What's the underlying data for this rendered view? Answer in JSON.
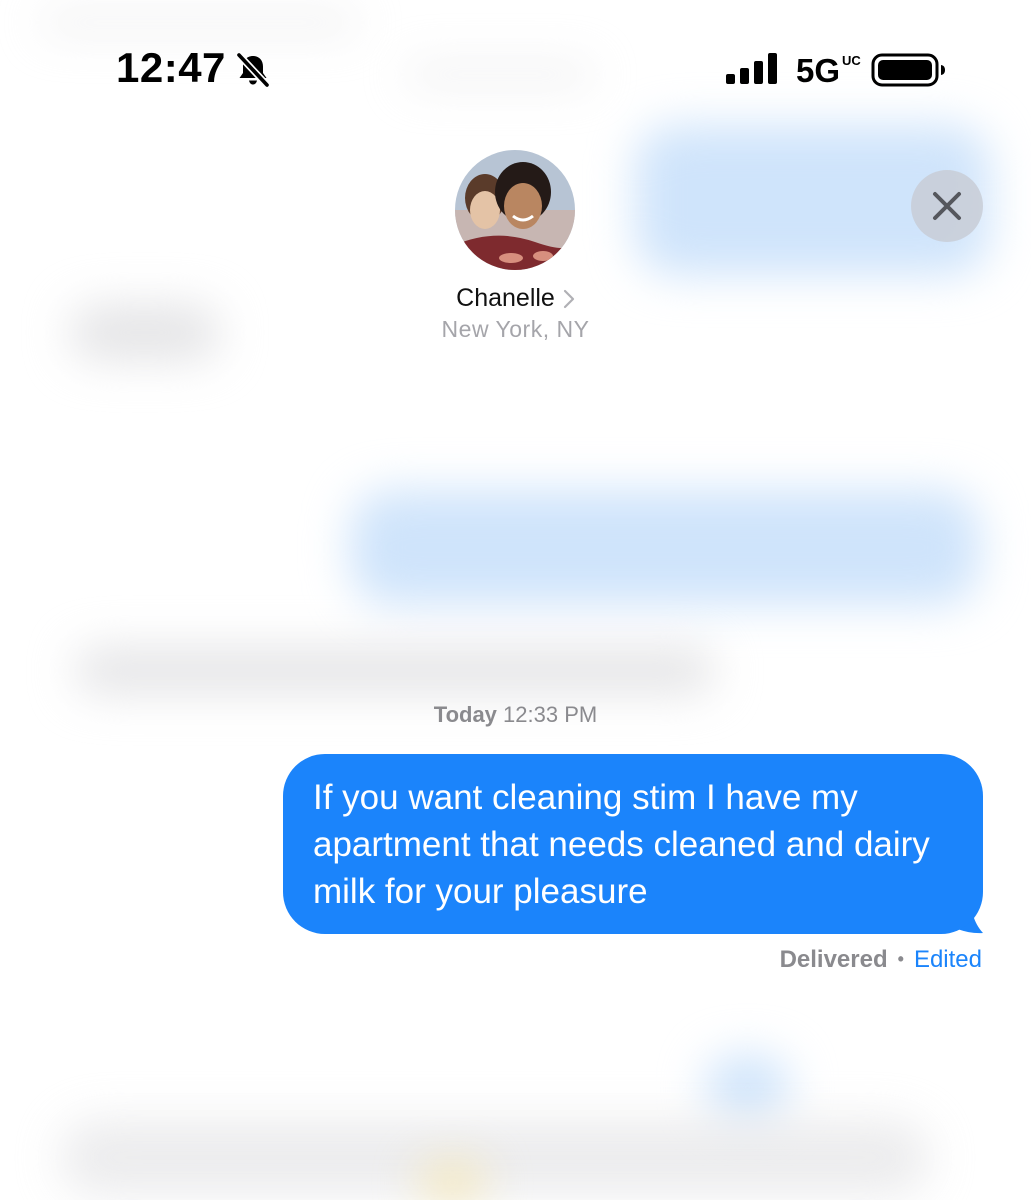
{
  "status_bar": {
    "time": "12:47",
    "network": "5G",
    "network_suffix": "UC",
    "mute_icon": "bell-slash-icon",
    "signal_icon": "cellular-signal-icon",
    "battery_icon": "battery-full-icon"
  },
  "contact": {
    "name": "Chanelle",
    "location": "New York, NY",
    "avatar_icon": "contact-photo"
  },
  "header": {
    "close_icon": "close-icon"
  },
  "conversation": {
    "timestamp_day": "Today",
    "timestamp_time": "12:33 PM",
    "message": {
      "text": "If you want cleaning stim I have my apartment that needs cleaned and dairy milk for your pleasure",
      "status": "Delivered",
      "separator": "•",
      "edited_label": "Edited"
    }
  },
  "colors": {
    "sent_bubble": "#1b84fb",
    "secondary_text": "#8a8a8e",
    "link": "#1b84fb"
  }
}
